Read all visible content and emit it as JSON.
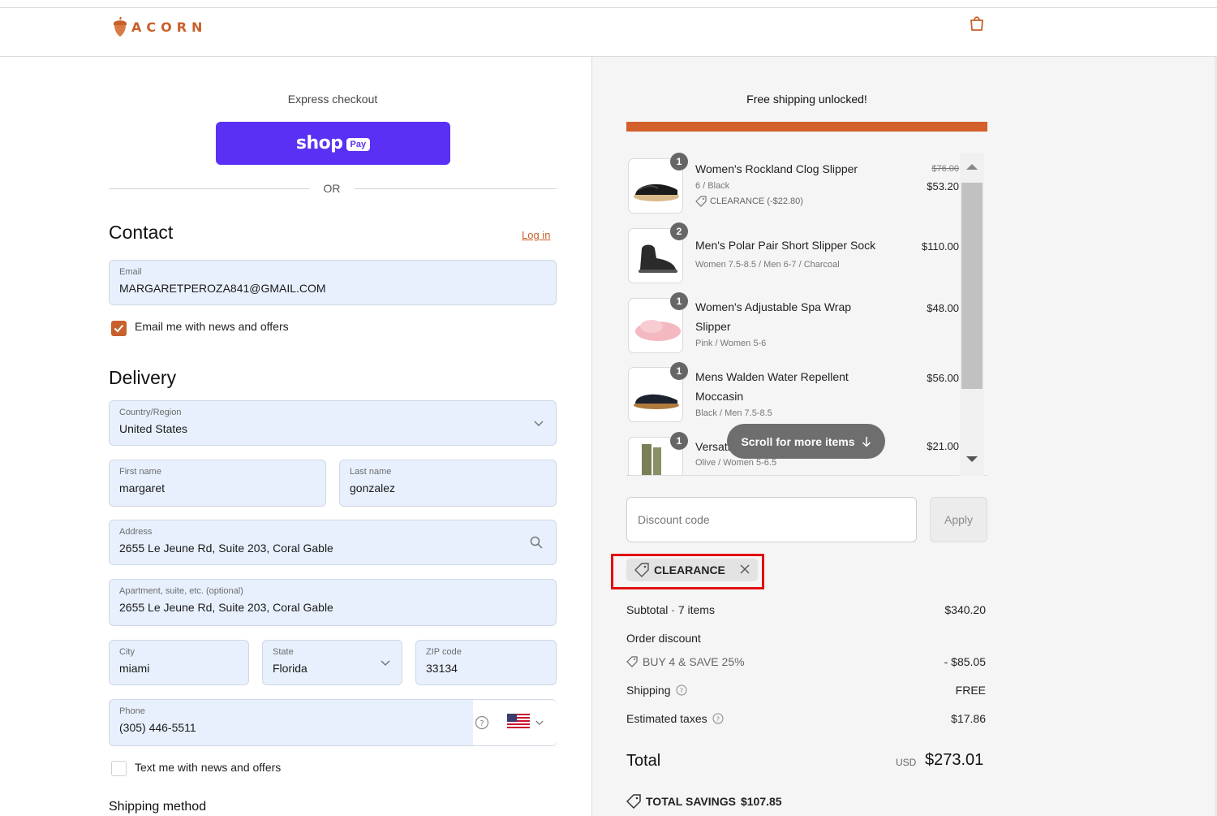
{
  "brand": {
    "name": "ACORN",
    "accent_color": "#c8602b"
  },
  "header": {
    "cart_icon": "shopping-bag-icon"
  },
  "express": {
    "label": "Express checkout",
    "shoppay_word": "shop",
    "shoppay_pay": "Pay",
    "shoppay_color": "#5a31f4",
    "or_text": "OR"
  },
  "contact": {
    "title": "Contact",
    "login_label": "Log in",
    "email": {
      "label": "Email",
      "value": "MARGARETPEROZA841@GMAIL.COM"
    },
    "news_checkbox": {
      "label": "Email me with news and offers",
      "checked": true
    }
  },
  "delivery": {
    "title": "Delivery",
    "country": {
      "label": "Country/Region",
      "value": "United States"
    },
    "first_name": {
      "label": "First name",
      "value": "margaret"
    },
    "last_name": {
      "label": "Last name",
      "value": "gonzalez"
    },
    "address": {
      "label": "Address",
      "value": "2655 Le Jeune Rd, Suite 203, Coral Gable"
    },
    "apartment": {
      "label": "Apartment, suite, etc. (optional)",
      "value": "2655 Le Jeune Rd, Suite 203, Coral Gable"
    },
    "city": {
      "label": "City",
      "value": "miami"
    },
    "state": {
      "label": "State",
      "value": "Florida"
    },
    "zip": {
      "label": "ZIP code",
      "value": "33134"
    },
    "phone": {
      "label": "Phone",
      "value": "(305) 446-5511"
    },
    "text_checkbox": {
      "label": "Text me with news and offers",
      "checked": false
    },
    "shipping_method_title": "Shipping method"
  },
  "summary": {
    "free_shipping": "Free shipping unlocked!",
    "progress_fraction": 1.0,
    "items": [
      {
        "qty": "1",
        "name": "Women's Rockland Clog Slipper",
        "variant": "6 / Black",
        "discount": "CLEARANCE (-$22.80)",
        "price_old": "$76.00",
        "price": "$53.20"
      },
      {
        "qty": "2",
        "name": "Men's Polar Pair Short Slipper Sock",
        "variant": "Women 7.5-8.5 / Men 6-7 / Charcoal",
        "price": "$110.00"
      },
      {
        "qty": "1",
        "name": "Women's Adjustable Spa Wrap Slipper",
        "variant": "Pink / Women 5-6",
        "price": "$48.00"
      },
      {
        "qty": "1",
        "name": "Mens Walden Water Repellent Moccasin",
        "variant": "Black / Men 7.5-8.5",
        "price": "$56.00"
      },
      {
        "qty": "1",
        "name": "Versati",
        "variant": "Olive / Women 5-6.5",
        "price": "$21.00"
      }
    ],
    "scroll_pill": "Scroll for more items",
    "discount_placeholder": "Discount code",
    "apply_label": "Apply",
    "applied_code": "CLEARANCE",
    "subtotal_label": "Subtotal · 7 items",
    "subtotal_value": "$340.20",
    "order_discount_label": "Order discount",
    "order_discount_code": "BUY 4 & SAVE 25%",
    "order_discount_value": "- $85.05",
    "shipping_label": "Shipping",
    "shipping_value": "FREE",
    "taxes_label": "Estimated taxes",
    "taxes_value": "$17.86",
    "total_label": "Total",
    "total_currency": "USD",
    "total_value": "$273.01",
    "savings_label": "TOTAL SAVINGS",
    "savings_value": "$107.85"
  }
}
